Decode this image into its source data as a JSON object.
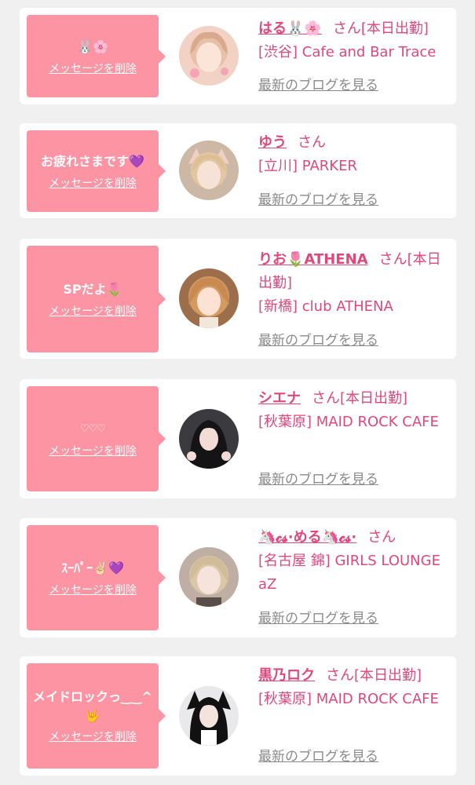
{
  "colors": {
    "bubble": "#fc94a4",
    "accent": "#e0487a",
    "muted": "#8a8a8a",
    "card": "#ffffff",
    "background": "#f0f0f0"
  },
  "cards": [
    {
      "message": "🐰🌸",
      "delete_label": "メッセージを削除",
      "name": "はる🐰🌸",
      "honorific": "さん",
      "status": "[本日出勤]",
      "shop": "[渋谷] Cafe and Bar Trace",
      "blog_link": "最新のブログを見る",
      "avatar_icon": "profile-photo"
    },
    {
      "message": "お疲れさまです💜",
      "delete_label": "メッセージを削除",
      "name": "ゆう",
      "honorific": "さん",
      "status": "",
      "shop": "[立川] PARKER",
      "blog_link": "最新のブログを見る",
      "avatar_icon": "profile-photo"
    },
    {
      "message": "SPだよ🌷",
      "delete_label": "メッセージを削除",
      "name": "りお🌷ATHENA",
      "honorific": "さん",
      "status": "[本日出勤]",
      "shop": "[新橋] club ATHENA",
      "blog_link": "最新のブログを見る",
      "avatar_icon": "profile-photo"
    },
    {
      "message": "♡♡♡",
      "delete_label": "メッセージを削除",
      "name": "シエナ",
      "honorific": "さん",
      "status": "[本日出勤]",
      "shop": "[秋葉原] MAID ROCK CAFE",
      "blog_link": "最新のブログを見る",
      "avatar_icon": "profile-photo"
    },
    {
      "message": "ｽｰﾊﾟｰ✌🏻💜",
      "delete_label": "メッセージを削除",
      "name": "🦄𝓬𝓼·める🦄𝓬𝓼·",
      "honorific": "さん",
      "status": "",
      "shop": "[名古屋 錦] GIRLS LOUNGE aZ",
      "blog_link": "最新のブログを見る",
      "avatar_icon": "profile-photo"
    },
    {
      "message": "メイドロックっ‿‿^🤟",
      "delete_label": "メッセージを削除",
      "name": "黒乃ロク",
      "honorific": "さん",
      "status": "[本日出勤]",
      "shop": "[秋葉原] MAID ROCK CAFE",
      "blog_link": "最新のブログを見る",
      "avatar_icon": "profile-photo"
    }
  ]
}
